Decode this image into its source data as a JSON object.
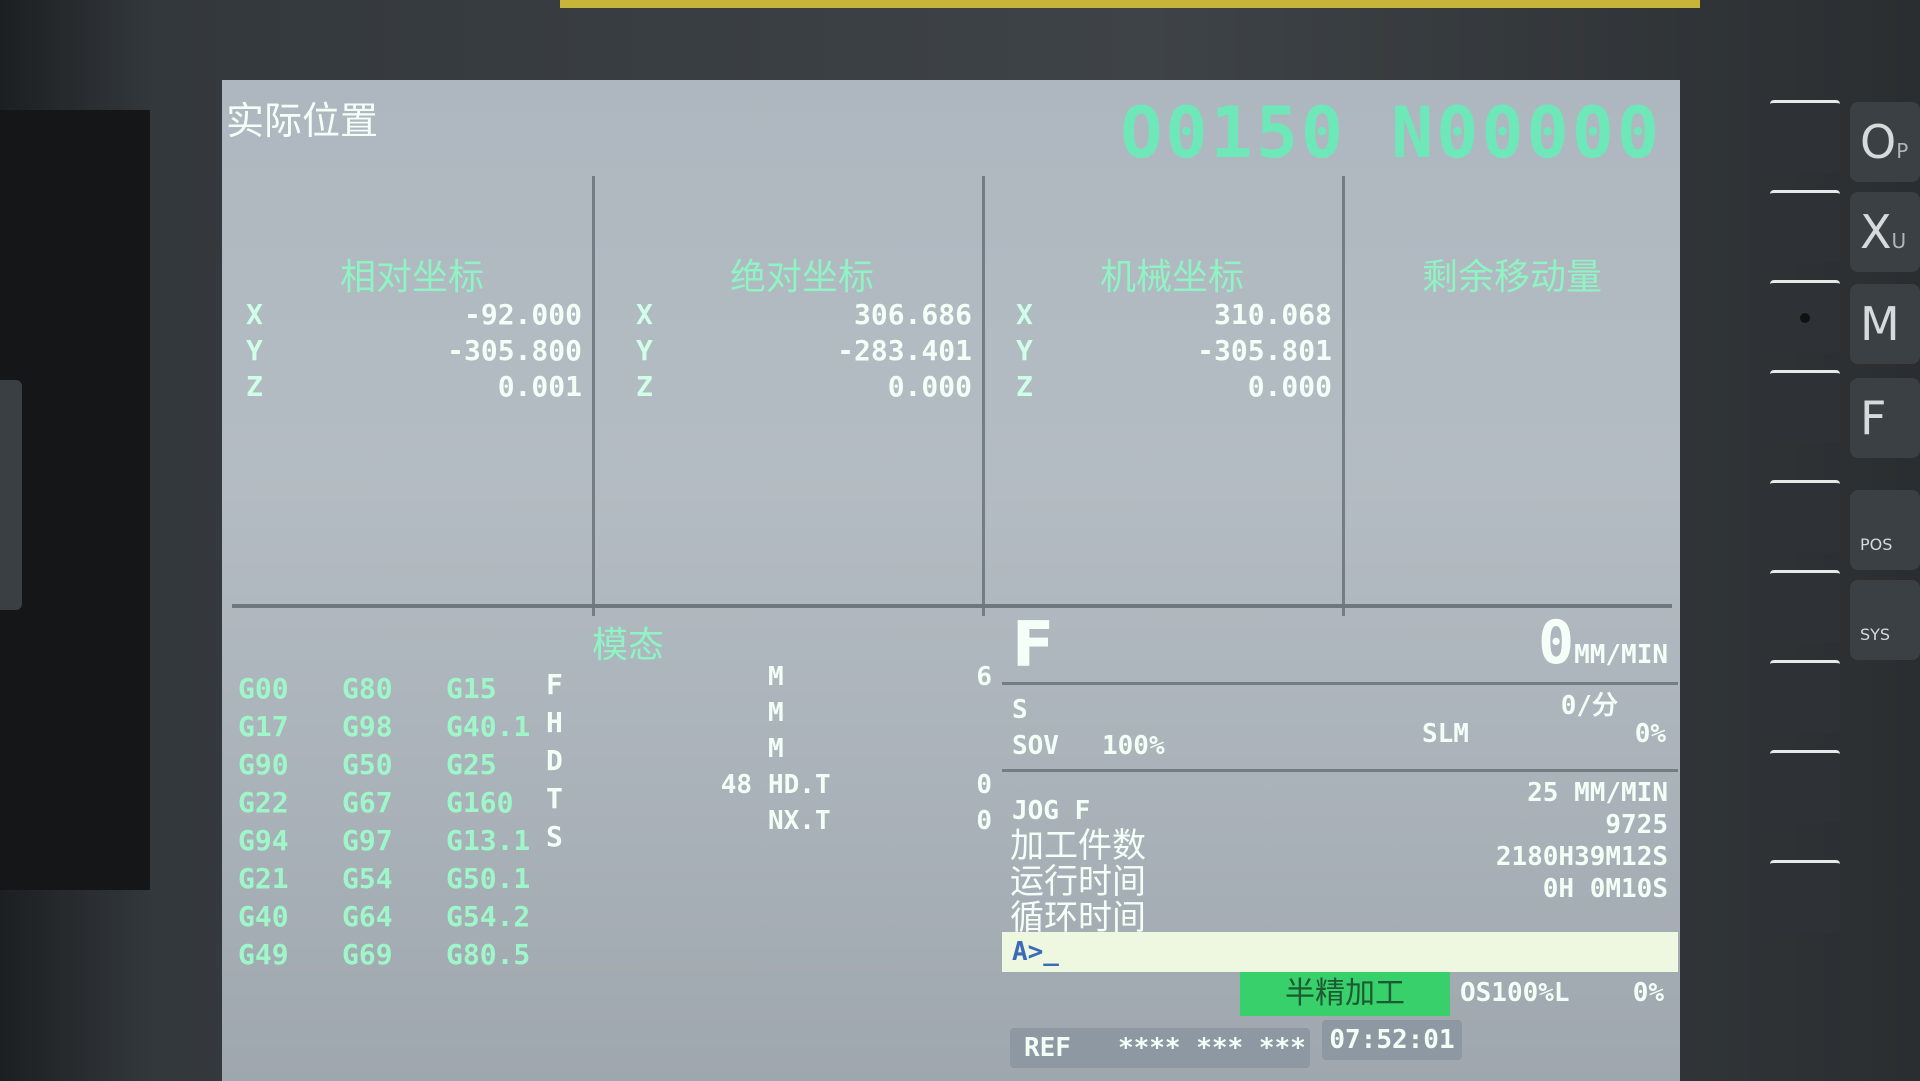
{
  "screen": {
    "title": "实际位置",
    "program": "O0150 N00000"
  },
  "positions": {
    "relative": {
      "title": "相对坐标",
      "X": "-92.000",
      "Y": "-305.800",
      "Z": "0.001"
    },
    "absolute": {
      "title": "绝对坐标",
      "X": "306.686",
      "Y": "-283.401",
      "Z": "0.000"
    },
    "machine": {
      "title": "机械坐标",
      "X": "310.068",
      "Y": "-305.801",
      "Z": "0.000"
    },
    "remaining": {
      "title": "剩余移动量"
    }
  },
  "axes": [
    "X",
    "Y",
    "Z"
  ],
  "modal": {
    "title": "模态",
    "col1": [
      "G00",
      "G17",
      "G90",
      "G22",
      "G94",
      "G21",
      "G40",
      "G49"
    ],
    "col2": [
      "G80",
      "G98",
      "G50",
      "G67",
      "G97",
      "G54",
      "G64",
      "G69"
    ],
    "col3": [
      "G15",
      "G40.1",
      "G25",
      "G160",
      "G13.1",
      "G50.1",
      "G54.2",
      "G80.5"
    ],
    "col4": [
      "F",
      "H",
      "D",
      "T",
      "S"
    ],
    "m_rows": [
      {
        "pre": "",
        "label": "M",
        "value": "6"
      },
      {
        "pre": "",
        "label": "M",
        "value": ""
      },
      {
        "pre": "",
        "label": "M",
        "value": ""
      },
      {
        "pre": "48",
        "label": "HD.T",
        "value": "0"
      },
      {
        "pre": "",
        "label": "NX.T",
        "value": "0"
      }
    ]
  },
  "feed": {
    "label": "F",
    "value": "0",
    "unit": "MM/MIN",
    "per_rev": "0/分"
  },
  "spindle": {
    "label": "S",
    "sov_label": "SOV",
    "sov_value": "100%",
    "slm_label": "SLM",
    "slm_value": "0%"
  },
  "info": {
    "jog_label": "JOG F",
    "jog_value": "25 MM/MIN",
    "parts_label": "加工件数",
    "parts_value": "9725",
    "run_label": "运行时间",
    "run_value": "2180H39M12S",
    "cycle_label": "循环时间",
    "cycle_value": "0H 0M10S"
  },
  "command_line": "A>_",
  "mode": {
    "name": "半精加工",
    "override": "OS100%L",
    "override2": "0%"
  },
  "status": {
    "ref": "REF",
    "ref_stars": "**** *** ***",
    "time": "07:52:01"
  },
  "keys": {
    "o": "O",
    "o_sub": "P",
    "x": "X",
    "x_sub": "U",
    "m": "M",
    "f": "F",
    "pos": "POS",
    "sys": "SYS"
  }
}
